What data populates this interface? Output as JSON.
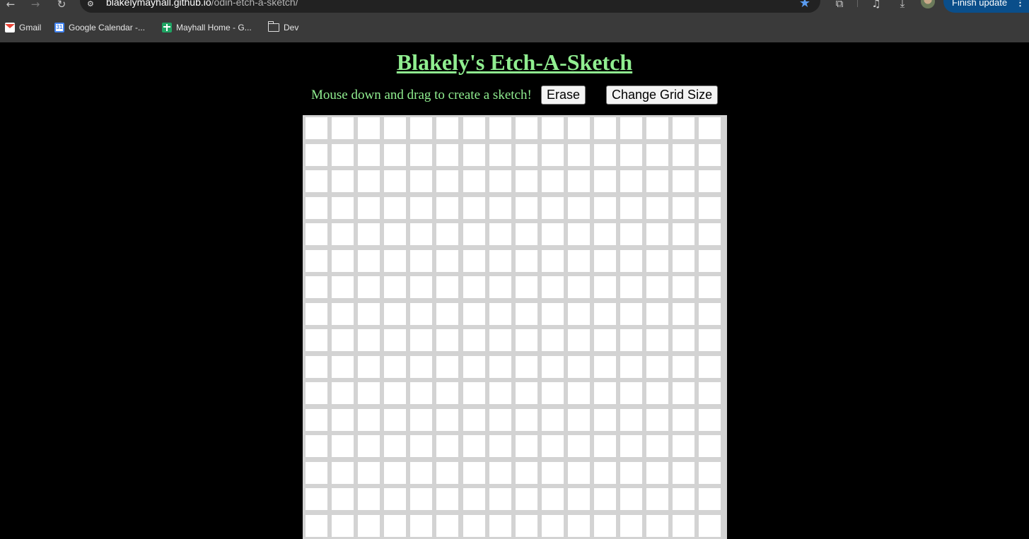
{
  "browser": {
    "url_host": "blakelymayhall.github.io",
    "url_path": "/odin-etch-a-sketch/",
    "finish_update_label": "Finish update",
    "bookmarks": [
      {
        "label": "Gmail",
        "icon": "gmail-icon"
      },
      {
        "label": "Google Calendar -...",
        "icon": "calendar-icon"
      },
      {
        "label": "Mayhall Home - G...",
        "icon": "sheets-icon"
      },
      {
        "label": "Dev",
        "icon": "folder-icon"
      }
    ]
  },
  "page": {
    "title": "Blakely's Etch-A-Sketch",
    "instructions": "Mouse down and drag to create a sketch!",
    "erase_label": "Erase",
    "change_grid_label": "Change Grid Size"
  },
  "grid": {
    "columns": 16,
    "rows": 16,
    "cell_color": "#ffffff",
    "border_color": "#d3d3d3"
  },
  "colors": {
    "accent": "#90ee90",
    "background": "#000000"
  }
}
